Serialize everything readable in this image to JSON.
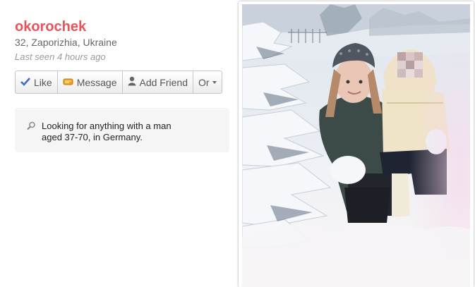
{
  "profile": {
    "username": "okorochek",
    "details": "32, Zaporizhia, Ukraine",
    "last_seen": "Last seen 4 hours ago"
  },
  "actions": {
    "like": "Like",
    "message": "Message",
    "add_friend": "Add Friend",
    "or": "Or"
  },
  "looking_for": {
    "text": "Looking for anything with a man aged 37-70, in Germany."
  },
  "icons": {
    "like": "checkmark-icon",
    "message": "message-icon",
    "add_friend": "person-icon",
    "or": "chevron-down-icon",
    "looking": "search-icon"
  },
  "colors": {
    "username": "#e8545a",
    "like_icon": "#3a6fc8",
    "message_icon": "#f0a020"
  }
}
